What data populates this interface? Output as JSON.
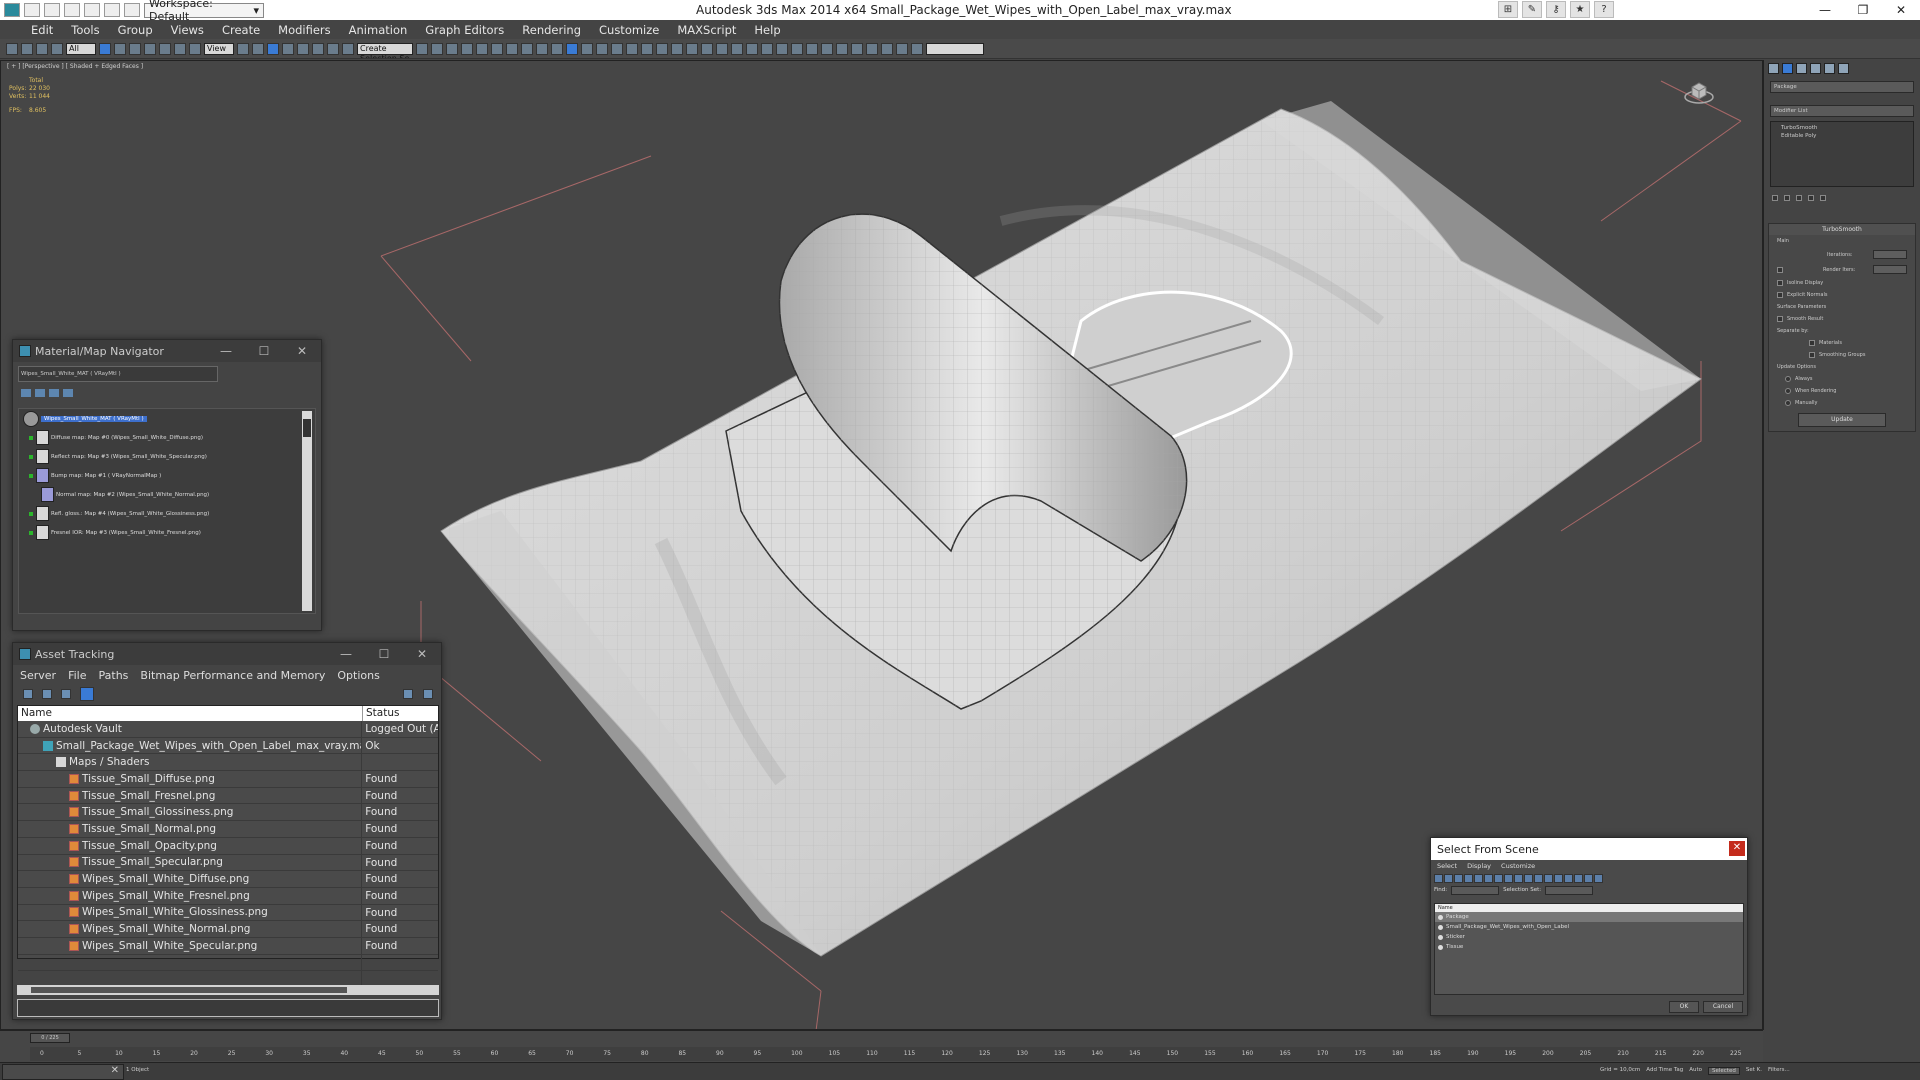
{
  "titlebar": {
    "workspace": "Workspace: Default",
    "app_title": "Autodesk 3ds Max  2014 x64     Small_Package_Wet_Wipes_with_Open_Label_max_vray.max"
  },
  "menu": [
    "Edit",
    "Tools",
    "Group",
    "Views",
    "Create",
    "Modifiers",
    "Animation",
    "Graph Editors",
    "Rendering",
    "Customize",
    "MAXScript",
    "Help"
  ],
  "toolbar": {
    "filter_value": "All",
    "ref_coord": "View",
    "named_sel": "Create Selection Se"
  },
  "viewport": {
    "label": "[ + ] [Perspective ] [ Shaded + Edged Faces ]",
    "stats": {
      "total_label": "Total",
      "polys_label": "Polys:",
      "polys_value": "22 030",
      "verts_label": "Verts:",
      "verts_value": "11 044",
      "fps_label": "FPS:",
      "fps_value": "8.605"
    }
  },
  "command_panel": {
    "object_name": "Package",
    "modifier_list": "Modifier List",
    "stack": [
      "TurboSmooth",
      "Editable Poly"
    ],
    "turbosmooth_title": "TurboSmooth",
    "main_label": "Main",
    "iterations_label": "Iterations:",
    "render_iters_label": "Render Iters:",
    "isoline_label": "Isoline Display",
    "explicit_normals_label": "Explicit Normals",
    "surface_params_label": "Surface Parameters",
    "smooth_result_label": "Smooth Result",
    "separate_by_label": "Separate by:",
    "materials_label": "Materials",
    "smoothing_groups_label": "Smoothing Groups",
    "update_options_label": "Update Options",
    "always_label": "Always",
    "when_rendering_label": "When Rendering",
    "manually_label": "Manually",
    "update_button": "Update"
  },
  "material_navigator": {
    "title": "Material/Map Navigator",
    "field_value": "Wipes_Small_White_MAT  ( VRayMtl )",
    "root": "Wipes_Small_White_MAT  ( VRayMtl )",
    "items": [
      "Diffuse map: Map #0 (Wipes_Small_White_Diffuse.png)",
      "Reflect map: Map #3 (Wipes_Small_White_Specular.png)",
      "Bump map: Map #1  ( VRayNormalMap )",
      "Normal map: Map #2 (Wipes_Small_White_Normal.png)",
      "Refl. gloss.: Map #4 (Wipes_Small_White_Glossiness.png)",
      "Fresnel IOR: Map #3 (Wipes_Small_White_Fresnel.png)"
    ]
  },
  "asset_tracking": {
    "title": "Asset Tracking",
    "menu": [
      "Server",
      "File",
      "Paths",
      "Bitmap Performance and Memory",
      "Options"
    ],
    "col_name": "Name",
    "col_status": "Status",
    "rows": [
      {
        "name": "Autodesk Vault",
        "status": "Logged Out (Ass...",
        "indent": 0,
        "icon": "vault"
      },
      {
        "name": "Small_Package_Wet_Wipes_with_Open_Label_max_vray.max",
        "status": "Ok",
        "indent": 1,
        "icon": "max"
      },
      {
        "name": "Maps / Shaders",
        "status": "",
        "indent": 2,
        "icon": "folder"
      },
      {
        "name": "Tissue_Small_Diffuse.png",
        "status": "Found",
        "indent": 3,
        "icon": "png"
      },
      {
        "name": "Tissue_Small_Fresnel.png",
        "status": "Found",
        "indent": 3,
        "icon": "png"
      },
      {
        "name": "Tissue_Small_Glossiness.png",
        "status": "Found",
        "indent": 3,
        "icon": "png"
      },
      {
        "name": "Tissue_Small_Normal.png",
        "status": "Found",
        "indent": 3,
        "icon": "png"
      },
      {
        "name": "Tissue_Small_Opacity.png",
        "status": "Found",
        "indent": 3,
        "icon": "png"
      },
      {
        "name": "Tissue_Small_Specular.png",
        "status": "Found",
        "indent": 3,
        "icon": "png"
      },
      {
        "name": "Wipes_Small_White_Diffuse.png",
        "status": "Found",
        "indent": 3,
        "icon": "png"
      },
      {
        "name": "Wipes_Small_White_Fresnel.png",
        "status": "Found",
        "indent": 3,
        "icon": "png"
      },
      {
        "name": "Wipes_Small_White_Glossiness.png",
        "status": "Found",
        "indent": 3,
        "icon": "png"
      },
      {
        "name": "Wipes_Small_White_Normal.png",
        "status": "Found",
        "indent": 3,
        "icon": "png"
      },
      {
        "name": "Wipes_Small_White_Specular.png",
        "status": "Found",
        "indent": 3,
        "icon": "png"
      }
    ]
  },
  "select_from_scene": {
    "title": "Select From Scene",
    "menu": [
      "Select",
      "Display",
      "Customize"
    ],
    "find_label": "Find:",
    "selection_set_label": "Selection Set:",
    "col_name": "Name",
    "items": [
      "Package",
      "Small_Package_Wet_Wipes_with_Open_Label",
      "Sticker",
      "Tissue"
    ],
    "ok": "OK",
    "cancel": "Cancel"
  },
  "timeline": {
    "frame": "0 / 225",
    "ticks": [
      "0",
      "5",
      "10",
      "15",
      "20",
      "25",
      "30",
      "35",
      "40",
      "45",
      "50",
      "55",
      "60",
      "65",
      "70",
      "75",
      "80",
      "85",
      "90",
      "95",
      "100",
      "105",
      "110",
      "115",
      "120",
      "125",
      "130",
      "135",
      "140",
      "145",
      "150",
      "155",
      "160",
      "165",
      "170",
      "175",
      "180",
      "185",
      "190",
      "195",
      "200",
      "205",
      "210",
      "215",
      "220",
      "225"
    ]
  },
  "statusbar": {
    "message": "1 Object",
    "grid": "Grid = 10,0cm",
    "auto": "Auto",
    "selected": "Selected",
    "add_time_tag": "Add Time Tag",
    "set_key": "Set K.",
    "filters": "Filters..."
  }
}
